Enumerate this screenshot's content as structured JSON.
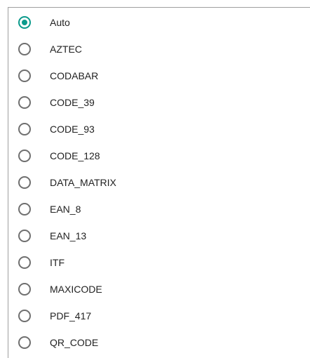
{
  "options": [
    {
      "label": "Auto",
      "checked": true
    },
    {
      "label": "AZTEC",
      "checked": false
    },
    {
      "label": "CODABAR",
      "checked": false
    },
    {
      "label": "CODE_39",
      "checked": false
    },
    {
      "label": "CODE_93",
      "checked": false
    },
    {
      "label": "CODE_128",
      "checked": false
    },
    {
      "label": "DATA_MATRIX",
      "checked": false
    },
    {
      "label": "EAN_8",
      "checked": false
    },
    {
      "label": "EAN_13",
      "checked": false
    },
    {
      "label": "ITF",
      "checked": false
    },
    {
      "label": "MAXICODE",
      "checked": false
    },
    {
      "label": "PDF_417",
      "checked": false
    },
    {
      "label": "QR_CODE",
      "checked": false
    }
  ],
  "colors": {
    "accent": "#0b9a8b",
    "radio_border": "#6f6f6f",
    "text": "#222222",
    "divider": "#9e9e9e"
  },
  "icons": {
    "checked": "radio-checked-icon",
    "unchecked": "radio-unchecked-icon"
  }
}
